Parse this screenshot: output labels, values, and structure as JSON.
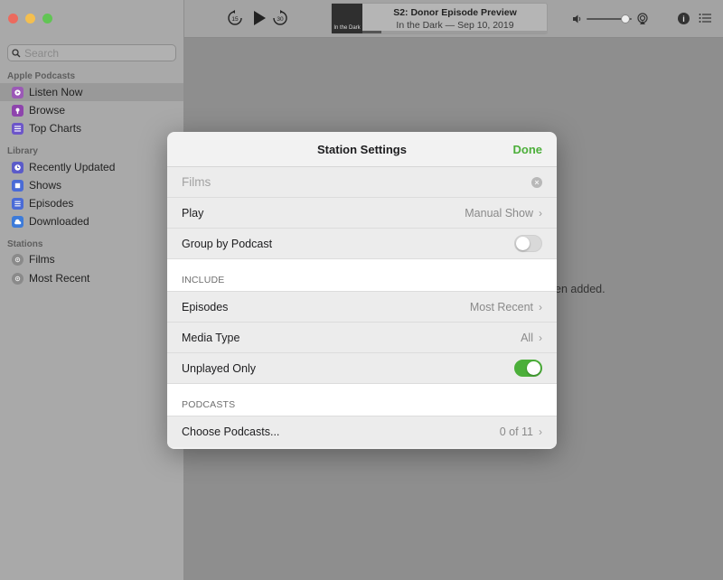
{
  "window": {
    "traffic_colors": [
      "#ec6a5e",
      "#f4bf4f",
      "#61c554"
    ]
  },
  "sidebar": {
    "search_placeholder": "Search",
    "sections": [
      {
        "title": "Apple Podcasts"
      },
      {
        "title": "Library"
      },
      {
        "title": "Stations"
      }
    ],
    "items": [
      {
        "label": "Listen Now",
        "icon": "listen-now-icon",
        "selected": true
      },
      {
        "label": "Browse",
        "icon": "browse-icon"
      },
      {
        "label": "Top Charts",
        "icon": "top-charts-icon"
      },
      {
        "label": "Recently Updated",
        "icon": "clock-icon"
      },
      {
        "label": "Shows",
        "icon": "shows-icon"
      },
      {
        "label": "Episodes",
        "icon": "episodes-icon"
      },
      {
        "label": "Downloaded",
        "icon": "download-icon"
      },
      {
        "label": "Films",
        "icon": "station-icon"
      },
      {
        "label": "Most Recent",
        "icon": "station-icon"
      }
    ]
  },
  "player": {
    "skip_back": "15",
    "skip_forward": "30",
    "artwork_text": "In the Dark",
    "episode_title": "S2: Donor Episode Preview",
    "episode_subtitle": "In the Dark — Sep 10, 2019",
    "progress": 0.1,
    "volume": 0.85
  },
  "background_text": "en added.",
  "modal": {
    "title": "Station Settings",
    "done_label": "Done",
    "name_value": "Films",
    "play": {
      "label": "Play",
      "value": "Manual Show"
    },
    "group_by_podcast": {
      "label": "Group by Podcast",
      "on": false
    },
    "include_header": "INCLUDE",
    "episodes": {
      "label": "Episodes",
      "value": "Most Recent"
    },
    "media_type": {
      "label": "Media Type",
      "value": "All"
    },
    "unplayed_only": {
      "label": "Unplayed Only",
      "on": true
    },
    "podcasts_header": "PODCASTS",
    "choose_podcasts": {
      "label": "Choose Podcasts...",
      "value": "0 of 11"
    }
  },
  "colors": {
    "accent_green": "#4caf3a",
    "icon_purple": "#8e44ad",
    "icon_blue": "#4a6bd6"
  }
}
